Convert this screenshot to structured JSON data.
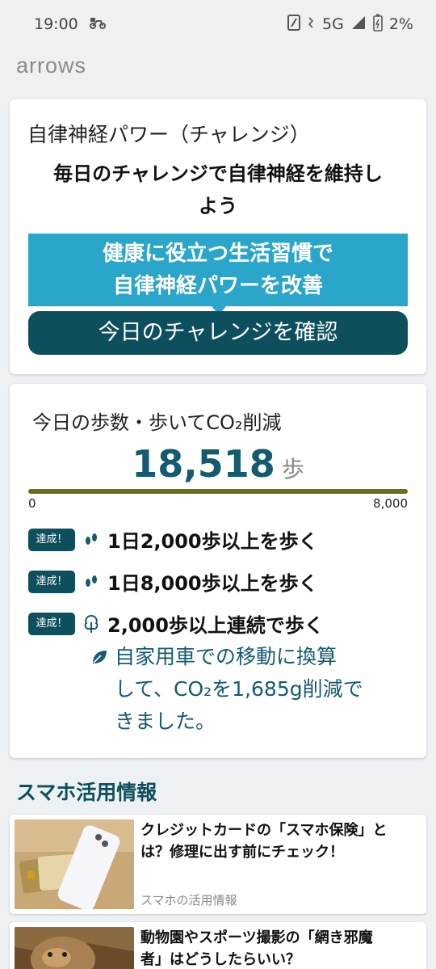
{
  "status_bar": {
    "time": "19:00",
    "network": "5G",
    "battery": "2%"
  },
  "brand": "arrows",
  "challenge_card": {
    "title": "自律神経パワー（チャレンジ）",
    "subtitle_line1": "毎日のチャレンジで自律神経を維持し",
    "subtitle_line2": "よう",
    "banner_line1": "健康に役立つ生活習慣で",
    "banner_line2": "自律神経パワーを改善",
    "button_label": "今日のチャレンジを確認"
  },
  "steps_card": {
    "title": "今日の歩数・歩いてCO₂削減",
    "steps": "18,518",
    "unit": "歩",
    "progress_fraction": 1.0,
    "scale_min": "0",
    "scale_max": "8,000",
    "achievements": [
      {
        "badge": "達成！",
        "icon": "footprints-icon",
        "text": "1日2,000歩以上を歩く"
      },
      {
        "badge": "達成！",
        "icon": "footprints-icon",
        "text": "1日8,000歩以上を歩く"
      },
      {
        "badge": "達成！",
        "icon": "tree-icon",
        "text": "2,000歩以上連続で歩く"
      }
    ],
    "co2_icon": "leaf-icon",
    "co2_line1": "自家用車での移動に換算",
    "co2_line2": "して、CO₂を1,685g削減で",
    "co2_line3": "きました。"
  },
  "section_heading": "スマホ活用情報",
  "articles": [
    {
      "title_line1": "クレジットカードの「スマホ保険」と",
      "title_line2": "は？修理に出す前にチェック！",
      "category": "スマホの活用情報"
    },
    {
      "title_line1": "動物園やスポーツ撮影の「網き邪魔",
      "title_line2": "者」はどうしたらいい？"
    }
  ],
  "colors": {
    "teal_dark": "#0d4f5c",
    "banner_blue": "#2aa6cb",
    "progress": "#6b6e12",
    "step_number": "#145a70"
  }
}
